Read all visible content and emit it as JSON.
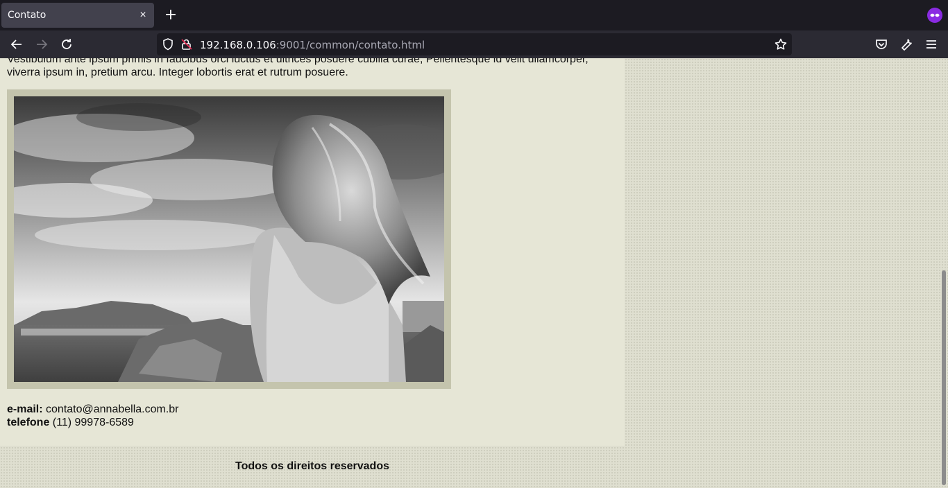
{
  "browser": {
    "tab_title": "Contato",
    "tab_close": "×",
    "new_tab": "+",
    "url_host": "192.168.0.106",
    "url_path": ":9001/common/contato.html"
  },
  "page": {
    "intro_line1": "Vestibulum ante ipsum primis in faucibus orci luctus et ultrices posuere cubilia curae; Pellentesque id velit ullamcorper,",
    "intro_line2": "viverra ipsum in, pretium arcu. Integer lobortis erat et rutrum posuere.",
    "email_label": "e-mail:",
    "email_value": "contato@annabella.com.br",
    "phone_label": "telefone",
    "phone_value": "(11) 99978-6589",
    "footer_text": "Todos os direitos reservados"
  },
  "icons": {
    "back": "back-arrow-icon",
    "forward": "forward-arrow-icon",
    "reload": "reload-icon",
    "shield": "shield-icon",
    "lock": "insecure-lock-icon",
    "star": "bookmark-star-icon",
    "pocket": "pocket-icon",
    "tools": "wrench-icon",
    "menu": "hamburger-menu-icon",
    "private": "private-browsing-icon"
  },
  "colors": {
    "page_bg": "#dfdfd0",
    "content_bg": "#e6e6d6",
    "frame_bg": "#c4c4ad",
    "private_accent": "#8a2be2"
  }
}
